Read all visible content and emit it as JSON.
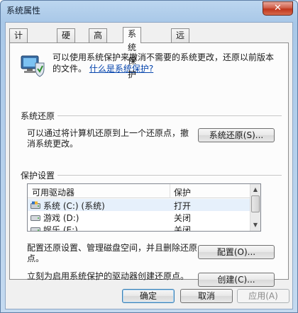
{
  "window": {
    "title": "系统属性",
    "close_glyph": "✕"
  },
  "tabs": [
    {
      "label": "计算机名"
    },
    {
      "label": "硬件"
    },
    {
      "label": "高级"
    },
    {
      "label": "系统保护"
    },
    {
      "label": "远程"
    }
  ],
  "intro": {
    "text": "可以使用系统保护来撤消不需要的系统更改，还原以前版本的文件。",
    "link": "什么是系统保护?"
  },
  "restore_group": {
    "title": "系统还原",
    "description": "可以通过将计算机还原到上一个还原点，撤消系统更改。",
    "button": "系统还原(S)..."
  },
  "protect_group": {
    "title": "保护设置",
    "columns": [
      "可用驱动器",
      "保护"
    ],
    "drives": [
      {
        "name": "系统 (C:) (系统)",
        "protection": "打开",
        "icon": "system-drive-icon"
      },
      {
        "name": "游戏 (D:)",
        "protection": "关闭",
        "icon": "drive-icon"
      },
      {
        "name": "娱乐 (E:)",
        "protection": "关闭",
        "icon": "drive-icon"
      }
    ],
    "configure_text": "配置还原设置、管理磁盘空间，并且删除还原点。",
    "configure_button": "配置(O)...",
    "create_text": "立刻为启用系统保护的驱动器创建还原点。",
    "create_button": "创建(C)..."
  },
  "footer": {
    "ok": "确定",
    "cancel": "取消",
    "apply": "应用(A)"
  }
}
